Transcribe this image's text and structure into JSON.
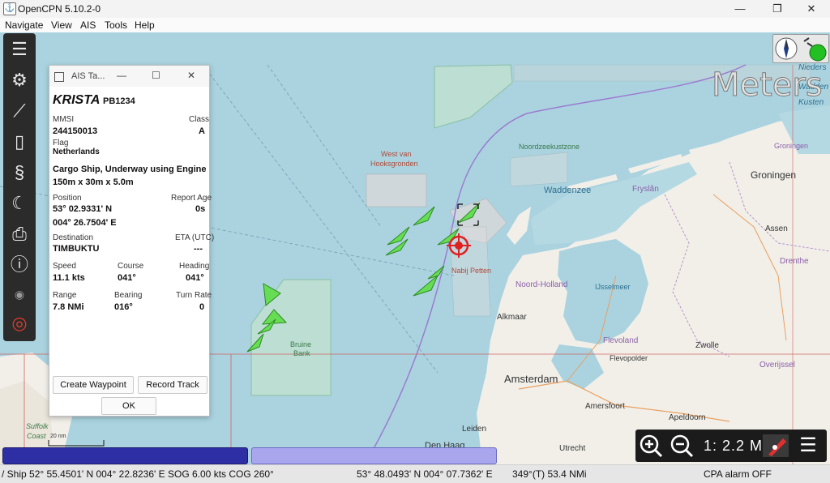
{
  "window": {
    "title": "OpenCPN 5.10.2-0",
    "minimize": "—",
    "maximize": "❐",
    "close": "✕"
  },
  "menu": [
    "Navigate",
    "View",
    "AIS",
    "Tools",
    "Help"
  ],
  "toolbar": {
    "icons": [
      "menu-icon",
      "gear-icon",
      "route-icon",
      "pages-icon",
      "track-icon",
      "night-mode-icon",
      "print-icon",
      "help-icon",
      "ais-icon",
      "lifebuoy-icon"
    ]
  },
  "map": {
    "overlay_text": "Meters",
    "place_labels": {
      "west_van": "West van",
      "hooksgronden": "Hooksgronden",
      "nabij_petten": "Nabij Petten",
      "bruine": "Bruine",
      "bank": "Bank",
      "noordzeekustzone": "Noordzeekustzone",
      "waddenzee": "Waddenzee",
      "fryslan": "Fryslân",
      "groningen": "Groningen",
      "groningen_small": "Groningen",
      "assen": "Assen",
      "drenthe": "Drenthe",
      "noord_holland": "Noord-Holland",
      "ijsselmeer": "IJsselmeer",
      "alkmaar": "Alkmaar",
      "amsterdam": "Amsterdam",
      "flevoland": "Flevoland",
      "flevopolder": "Flevopolder",
      "zwolle": "Zwolle",
      "overijssel": "Overijssel",
      "leiden": "Leiden",
      "amersfoort": "Amersfoort",
      "apeldoorn": "Apeldoorn",
      "utrecht": "Utrecht",
      "den_haag": "Den Haag",
      "suffolk": "Suffolk",
      "coast": "Coast",
      "scale_bar": "20 nm",
      "nieder": "Nieders",
      "wadden": "Wadden",
      "kusten": "Kusten"
    }
  },
  "ais_dialog": {
    "title": "AIS Ta...",
    "minimize": "—",
    "maximize": "☐",
    "close": "✕",
    "name": "KRISTA",
    "callsign": "PB1234",
    "labels": {
      "mmsi": "MMSI",
      "class": "Class",
      "flag": "Flag",
      "position": "Position",
      "report_age": "Report Age",
      "destination": "Destination",
      "eta": "ETA (UTC)",
      "speed": "Speed",
      "course": "Course",
      "heading": "Heading",
      "range": "Range",
      "bearing": "Bearing",
      "turn_rate": "Turn Rate"
    },
    "values": {
      "mmsi": "244150013",
      "class": "A",
      "flag": "Netherlands",
      "type_status": "Cargo Ship, Underway using Engine",
      "dimensions": "150m x 30m x 5.0m",
      "lat": "53° 02.9331' N",
      "lon": "004° 26.7504' E",
      "report_age": "0s",
      "destination": "TIMBUKTU",
      "eta": "---",
      "speed": "11.1 kts",
      "course": "041°",
      "heading": "041°",
      "range": "7.8 NMi",
      "bearing": "016°",
      "turn_rate": "0"
    },
    "buttons": {
      "create_waypoint": "Create Waypoint",
      "record_track": "Record Track",
      "ok": "OK"
    }
  },
  "zoom": {
    "zoom_in": "+",
    "zoom_out": "−",
    "scale": "1: 2.2 M"
  },
  "status": {
    "ship": "/ Ship 52° 55.4501' N   004° 22.8236' E SOG 6.00 kts   COG 260°",
    "cursor": "53° 48.0493' N   004° 07.7362' E",
    "bearing_range": "349°(T)   53.4 NMi",
    "cpa": "CPA alarm OFF"
  },
  "colors": {
    "sea": "#aad3df",
    "land": "#f2efe9",
    "ais_target": "#66dd55",
    "own_ship": "#e02020",
    "progress_dark": "#2f2fa5",
    "progress_light": "#a9a6ee"
  }
}
